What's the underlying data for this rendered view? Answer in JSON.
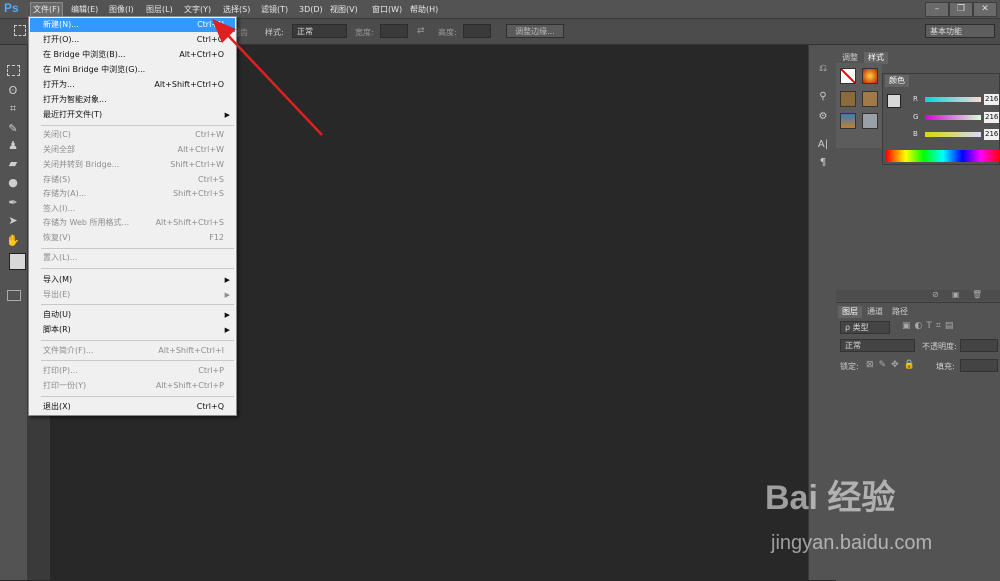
{
  "app": {
    "logo": "Ps"
  },
  "menubar": {
    "items": [
      {
        "label": "文件(F)"
      },
      {
        "label": "编辑(E)"
      },
      {
        "label": "图像(I)"
      },
      {
        "label": "图层(L)"
      },
      {
        "label": "文字(Y)"
      },
      {
        "label": "选择(S)"
      },
      {
        "label": "滤镜(T)"
      },
      {
        "label": "3D(D)"
      },
      {
        "label": "视图(V)"
      },
      {
        "label": "窗口(W)"
      },
      {
        "label": "帮助(H)"
      }
    ],
    "window_buttons": [
      "–",
      "❐",
      "✕"
    ]
  },
  "options_bar": {
    "partial_label": "锯齿",
    "style_label": "样式:",
    "style_value": "正常",
    "width_label": "宽度:",
    "height_label": "高度:",
    "refine_edge": "调整边缘...",
    "workspace": "基本功能"
  },
  "file_menu": {
    "items": [
      {
        "label": "新建(N)...",
        "shortcut": "Ctrl+N",
        "highlighted": true
      },
      {
        "label": "打开(O)...",
        "shortcut": "Ctrl+O"
      },
      {
        "label": "在 Bridge 中浏览(B)...",
        "shortcut": "Alt+Ctrl+O"
      },
      {
        "label": "在 Mini Bridge 中浏览(G)...",
        "shortcut": ""
      },
      {
        "label": "打开为...",
        "shortcut": "Alt+Shift+Ctrl+O"
      },
      {
        "label": "打开为智能对象...",
        "shortcut": ""
      },
      {
        "label": "最近打开文件(T)",
        "shortcut": "",
        "submenu": true
      },
      {
        "label": "关闭(C)",
        "shortcut": "Ctrl+W",
        "disabled": true
      },
      {
        "label": "关闭全部",
        "shortcut": "Alt+Ctrl+W",
        "disabled": true
      },
      {
        "label": "关闭并转到 Bridge...",
        "shortcut": "Shift+Ctrl+W",
        "disabled": true
      },
      {
        "label": "存储(S)",
        "shortcut": "Ctrl+S",
        "disabled": true
      },
      {
        "label": "存储为(A)...",
        "shortcut": "Shift+Ctrl+S",
        "disabled": true
      },
      {
        "label": "签入(I)...",
        "shortcut": "",
        "disabled": true
      },
      {
        "label": "存储为 Web 所用格式...",
        "shortcut": "Alt+Shift+Ctrl+S",
        "disabled": true
      },
      {
        "label": "恢复(V)",
        "shortcut": "F12",
        "disabled": true
      },
      {
        "label": "置入(L)...",
        "shortcut": "",
        "disabled": true
      },
      {
        "label": "导入(M)",
        "shortcut": "",
        "submenu": true
      },
      {
        "label": "导出(E)",
        "shortcut": "",
        "submenu": true,
        "disabled": true
      },
      {
        "label": "自动(U)",
        "shortcut": "",
        "submenu": true
      },
      {
        "label": "脚本(R)",
        "shortcut": "",
        "submenu": true
      },
      {
        "label": "文件简介(F)...",
        "shortcut": "Alt+Shift+Ctrl+I",
        "disabled": true
      },
      {
        "label": "打印(P)...",
        "shortcut": "Ctrl+P",
        "disabled": true
      },
      {
        "label": "打印一份(Y)",
        "shortcut": "Alt+Shift+Ctrl+P",
        "disabled": true
      },
      {
        "label": "退出(X)",
        "shortcut": "Ctrl+Q"
      }
    ]
  },
  "panels": {
    "top_tabs": [
      "调整",
      "样式"
    ],
    "color_tab": "颜色",
    "color": {
      "r_label": "R",
      "g_label": "G",
      "b_label": "B",
      "r": "216",
      "g": "216",
      "b": "216"
    },
    "layers_tabs": [
      "图层",
      "通道",
      "路径"
    ],
    "layer_filter": "ρ 类型",
    "blend_mode": "正常",
    "opacity_label": "不透明度:",
    "lock_label": "锁定:",
    "fill_label": "填充:"
  },
  "watermark": {
    "logo": "Bai  经验",
    "url": "jingyan.baidu.com"
  },
  "colors": {
    "accent": "#3399ff",
    "menu_bg": "#f0f0f0",
    "ui_bg": "#535353",
    "canvas": "#282828",
    "arrow": "#e02020"
  }
}
